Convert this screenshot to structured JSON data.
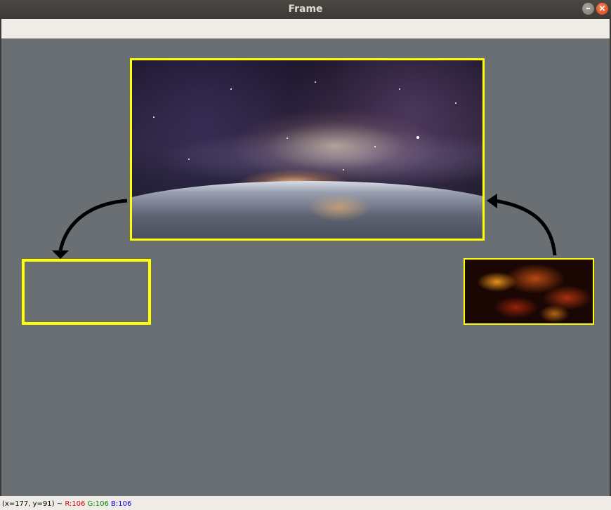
{
  "window": {
    "title": "Frame",
    "buttons": {
      "minimize": "–",
      "close": "×"
    }
  },
  "canvas": {
    "background_color": "#6a6f73",
    "box_color": "#ffff00"
  },
  "images": {
    "main": "space-earth-horizon-image",
    "source": "orange-nebula-image"
  },
  "status": {
    "coords": "(x=177, y=91) ~",
    "r": "R:106",
    "g": "G:106",
    "b": "B:106"
  }
}
